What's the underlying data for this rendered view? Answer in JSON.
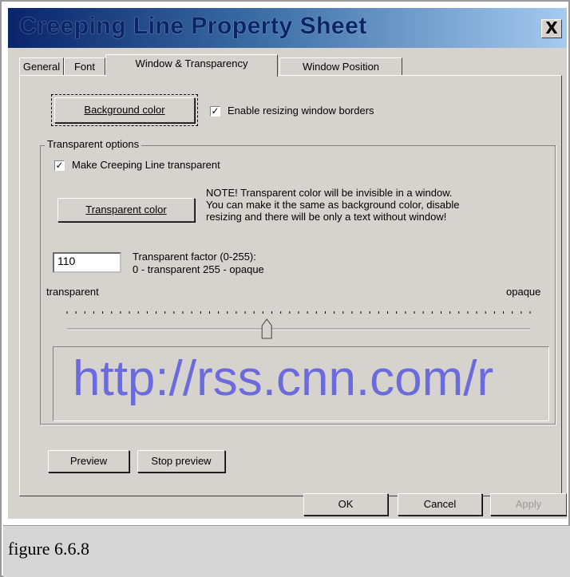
{
  "window": {
    "title": "Creeping Line Property Sheet",
    "close_glyph": "X"
  },
  "tabs": [
    {
      "label": "General",
      "active": false
    },
    {
      "label": "Font",
      "active": false
    },
    {
      "label": "Window & Transparency",
      "active": true
    },
    {
      "label": "Window Position",
      "active": false
    }
  ],
  "main": {
    "background_color_button": "Background color",
    "enable_resizing_label": "Enable resizing window borders",
    "enable_resizing_checked": true,
    "group_title": "Transparent options",
    "make_transparent_label": "Make Creeping Line transparent",
    "make_transparent_checked": true,
    "transparent_color_button": "Transparent color",
    "note_lines": [
      "NOTE! Transparent color will be invisible in a window.",
      "You can make it the same as background color, disable",
      "resizing and there will be only a text without window!"
    ],
    "transparent_factor_value": "110",
    "transparent_factor_label_1": "Transparent factor (0-255):",
    "transparent_factor_label_2": "0 - transparent   255 - opaque",
    "slider_min_label": "transparent",
    "slider_max_label": "opaque",
    "slider_value": 110,
    "slider_max": 255,
    "preview_text": "http://rss.cnn.com/r",
    "preview_color": "#6b6bdc",
    "preview_button": "Preview",
    "stop_preview_button": "Stop preview"
  },
  "footer": {
    "ok": "OK",
    "cancel": "Cancel",
    "apply": "Apply"
  },
  "caption": "figure 6.6.8"
}
